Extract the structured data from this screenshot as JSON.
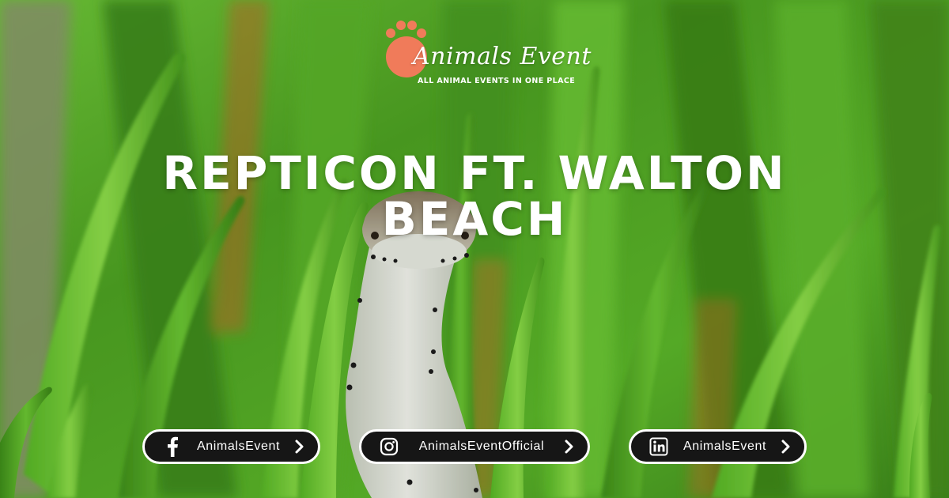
{
  "logo": {
    "name": "Animals Event",
    "tagline": "ALL ANIMAL EVENTS IN ONE PLACE",
    "paw_color": "#f07b5a"
  },
  "headline": {
    "line1": "REPTICON FT. WALTON",
    "line2": "BEACH"
  },
  "social": {
    "facebook": {
      "icon": "facebook-icon",
      "label": "AnimalsEvent"
    },
    "instagram": {
      "icon": "instagram-icon",
      "label": "AnimalsEventOfficial"
    },
    "linkedin": {
      "icon": "linkedin-icon",
      "label": "AnimalsEvent"
    }
  },
  "colors": {
    "grass": "#5fbf2a",
    "pill_background": "#161616",
    "pill_border": "#ffffff",
    "text": "#ffffff"
  }
}
